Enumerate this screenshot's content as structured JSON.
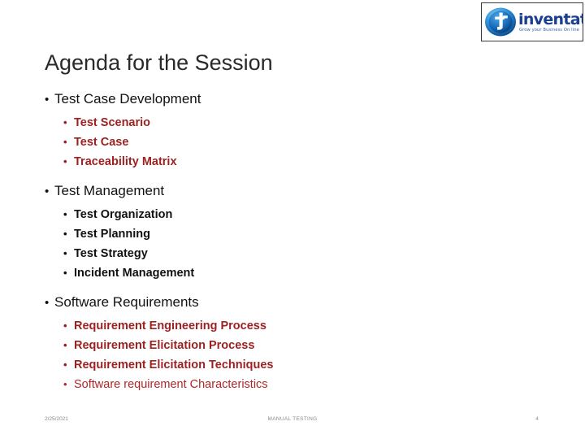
{
  "logo": {
    "name": "inventateq",
    "tagline": "Grow your Business On line",
    "emblem_color": "#1b6fc4",
    "name_color": "#1b3f8f"
  },
  "title": "Agenda for the Session",
  "bullet_glyph": "•",
  "colors": {
    "heading": "#2a2a2a",
    "level1": "#111111",
    "red": "#9e2122",
    "red_light": "#b22626",
    "footer": "#8a8a8a"
  },
  "sections": [
    {
      "heading": "Test Case Development",
      "sub_color": "red",
      "items": [
        "Test Scenario",
        "Test Case",
        "Traceability Matrix"
      ]
    },
    {
      "heading": "Test Management",
      "sub_color": "black",
      "items": [
        "Test Organization",
        "Test Planning",
        "Test Strategy",
        "Incident Management"
      ]
    },
    {
      "heading": "Software Requirements",
      "sub_color": "red",
      "items": [
        "Requirement Engineering Process",
        "Requirement Elicitation Process",
        "Requirement Elicitation Techniques",
        "Software requirement Characteristics"
      ]
    }
  ],
  "footer": {
    "date": "2/25/2021",
    "title": "MANUAL TESTING",
    "page": "4"
  }
}
